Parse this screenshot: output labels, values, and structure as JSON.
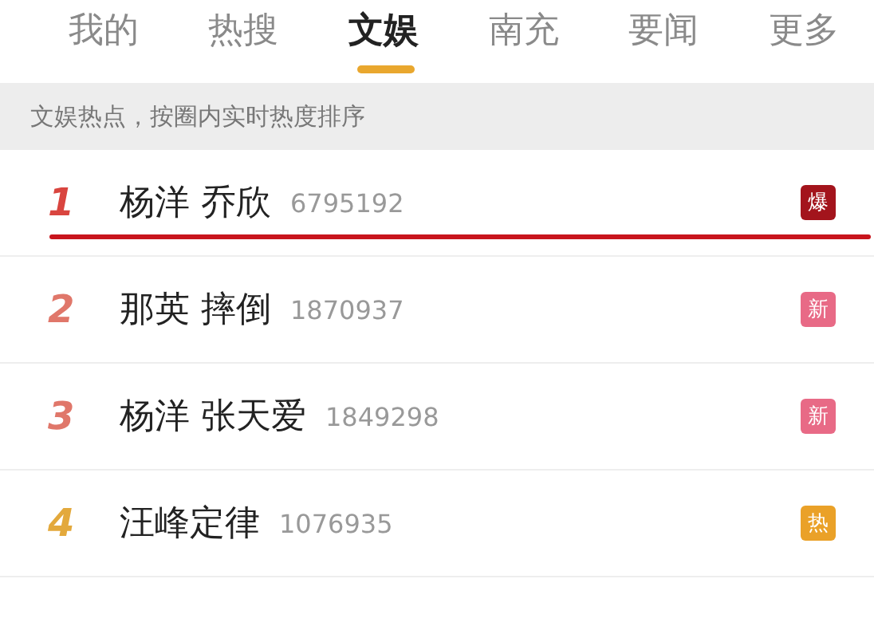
{
  "tabs": [
    {
      "label": "我的",
      "selected": false
    },
    {
      "label": "热搜",
      "selected": false
    },
    {
      "label": "文娱",
      "selected": true
    },
    {
      "label": "南充",
      "selected": false
    },
    {
      "label": "要闻",
      "selected": false
    },
    {
      "label": "更多",
      "selected": false
    }
  ],
  "banner": "文娱热点，按圈内实时热度排序",
  "rows": [
    {
      "rank": {
        "text": "1",
        "color": "#d9453f"
      },
      "title": "杨洋 乔欣",
      "count": "6795192",
      "badge": {
        "text": "爆",
        "color": "#a3141c"
      },
      "marked": true
    },
    {
      "rank": {
        "text": "2",
        "color": "#e0776a"
      },
      "title": "那英 摔倒",
      "count": "1870937",
      "badge": {
        "text": "新",
        "color": "#e86a86"
      },
      "marked": false
    },
    {
      "rank": {
        "text": "3",
        "color": "#e0776a"
      },
      "title": "杨洋 张天爱",
      "count": "1849298",
      "badge": {
        "text": "新",
        "color": "#e86a86"
      },
      "marked": false
    },
    {
      "rank": {
        "text": "4",
        "color": "#e3a93c"
      },
      "title": "汪峰定律",
      "count": "1076935",
      "badge": {
        "text": "热",
        "color": "#eaa128"
      },
      "marked": false
    }
  ]
}
